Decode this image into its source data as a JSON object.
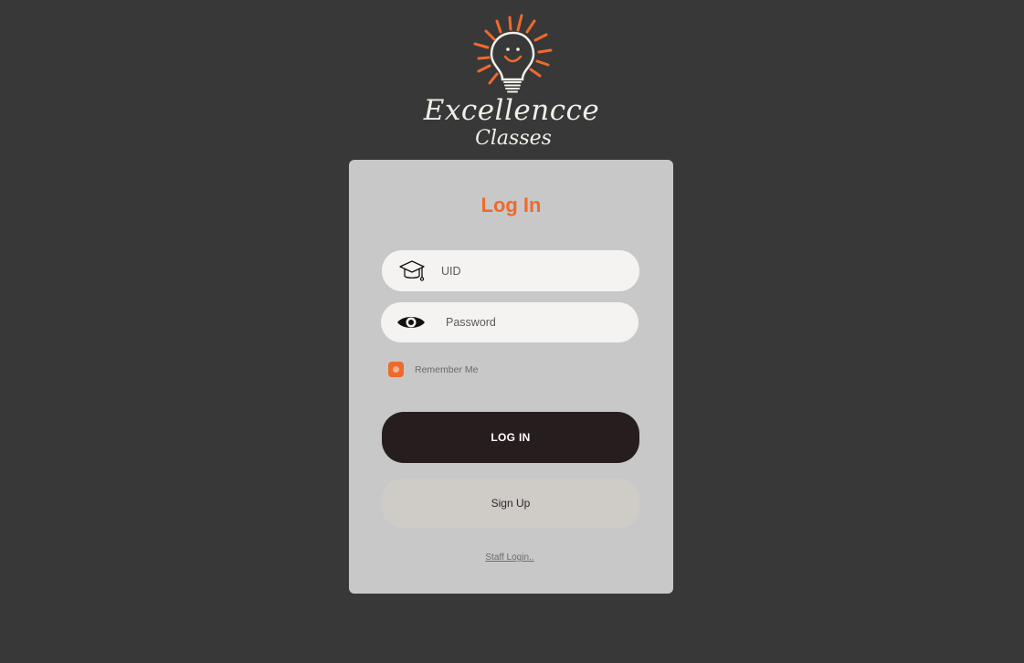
{
  "brand": {
    "title": "Excellencce",
    "subtitle": "Classes",
    "logo_icon": "lightbulb-smile-icon",
    "accent_color": "#ee6a2c"
  },
  "login_card": {
    "title": "Log In",
    "uid_field": {
      "icon": "graduation-cap-icon",
      "placeholder": "UID",
      "value": ""
    },
    "password_field": {
      "icon": "eye-icon",
      "placeholder": "Password",
      "value": ""
    },
    "remember_me": {
      "label": "Remember Me",
      "checked": true
    },
    "login_button_label": "LOG IN",
    "signup_button_label": "Sign Up",
    "staff_login_link": "Staff Login.."
  },
  "colors": {
    "background": "#383838",
    "card": "#c8c8c8",
    "login_button": "#261e1e",
    "signup_button": "#cfcbc6"
  }
}
